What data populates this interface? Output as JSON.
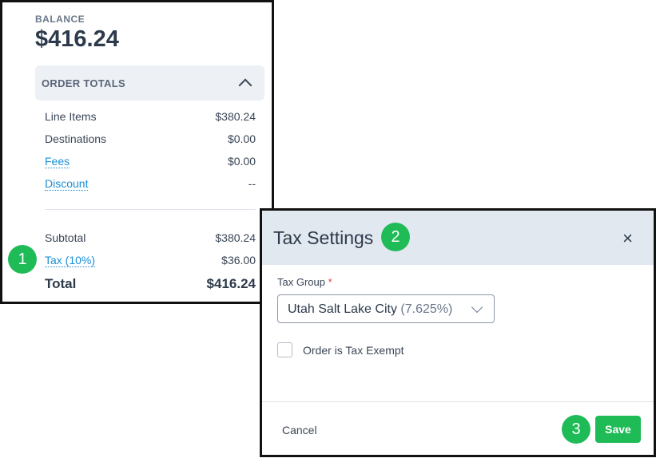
{
  "balance": {
    "label": "BALANCE",
    "value": "$416.24"
  },
  "order_totals": {
    "title": "ORDER TOTALS",
    "rows": [
      {
        "label": "Line Items",
        "value": "$380.24"
      },
      {
        "label": "Destinations",
        "value": "$0.00"
      },
      {
        "label": "Fees",
        "value": "$0.00"
      },
      {
        "label": "Discount",
        "value": "--"
      }
    ],
    "subtotal": {
      "label": "Subtotal",
      "value": "$380.24"
    },
    "tax": {
      "label": "Tax (10%)",
      "value": "$36.00"
    },
    "total": {
      "label": "Total",
      "value": "$416.24"
    }
  },
  "badges": [
    "1",
    "2",
    "3"
  ],
  "tax_modal": {
    "title": "Tax Settings",
    "close_icon": "×",
    "field_label": "Tax Group",
    "required_mark": "*",
    "select_value": "Utah Salt Lake City",
    "select_rate": "(7.625%)",
    "checkbox_label": "Order is Tax Exempt",
    "cancel_label": "Cancel",
    "save_label": "Save"
  },
  "colors": {
    "accent_green": "#1fbb57",
    "link_blue": "#1a8fd6",
    "header_bg": "#e2e8ef"
  }
}
